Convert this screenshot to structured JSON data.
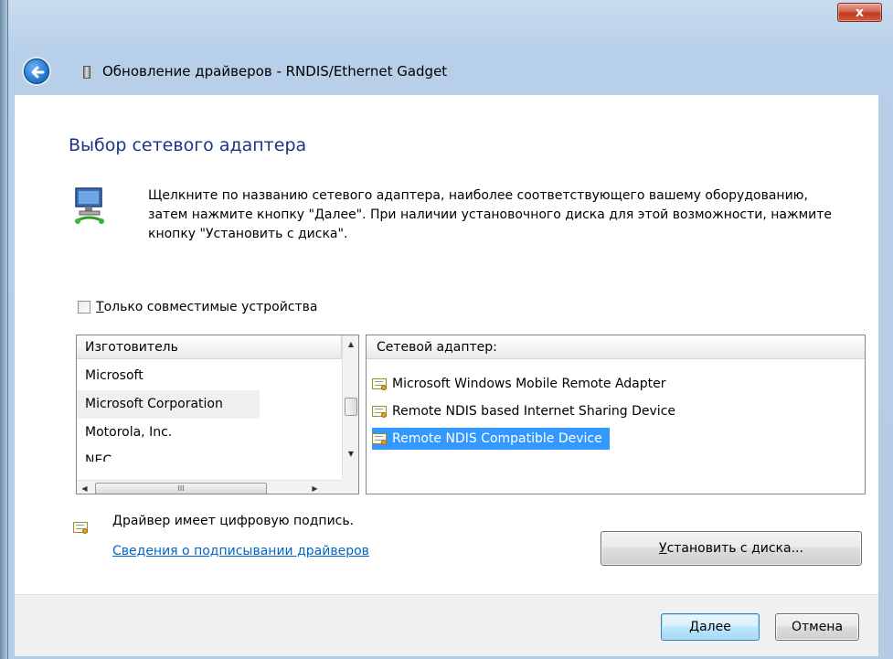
{
  "window": {
    "title": "Обновление драйверов - RNDIS/Ethernet Gadget",
    "close_label": "x"
  },
  "page": {
    "heading": "Выбор сетевого адаптера",
    "instruction": "Щелкните по названию сетевого адаптера, наиболее соответствующего вашему оборудованию, затем нажмите кнопку \"Далее\". При наличии установочного диска для этой возможности, нажмите кнопку \"Установить с диска\"."
  },
  "compatible_checkbox": {
    "label_first": "Т",
    "label_rest": "олько совместимые устройства",
    "checked": false
  },
  "manufacturers": {
    "header": "Изготовитель",
    "items": [
      "Microsoft",
      "Microsoft Corporation",
      "Motorola, Inc.",
      "NEC"
    ],
    "selected_index": 1
  },
  "models": {
    "header": "Сетевой адаптер:",
    "items": [
      "Microsoft Windows Mobile Remote Adapter",
      "Remote NDIS based Internet Sharing Device",
      "Remote NDIS Compatible Device"
    ],
    "selected_index": 2
  },
  "signature": {
    "text": "Драйвер имеет цифровую подпись.",
    "link": "Сведения о подписывании драйверов"
  },
  "buttons": {
    "have_disk_first": "У",
    "have_disk_rest": "становить с диска...",
    "next_first": "Д",
    "next_rest": "алее",
    "cancel": "Отмена"
  },
  "scroll": {
    "up_arrow": "▲",
    "down_arrow": "▼",
    "left_arrow": "◀",
    "right_arrow": "▶",
    "grip": "III"
  },
  "icons": {
    "back": "back-arrow-icon",
    "device": "device-icon",
    "network": "network-adapter-icon",
    "certificate": "certificate-icon"
  }
}
